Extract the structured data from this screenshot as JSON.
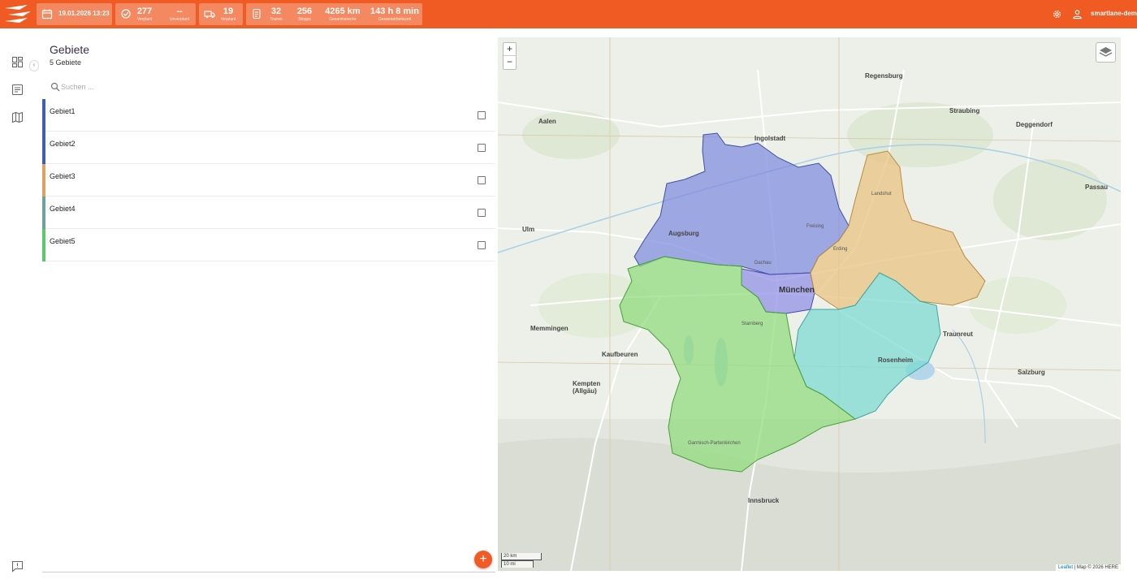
{
  "topbar": {
    "date": "19.01.2026 13:23",
    "stats_a": [
      {
        "value": "277",
        "label": "Verplant"
      },
      {
        "value": "--",
        "label": "Unverplant"
      }
    ],
    "stats_b": [
      {
        "value": "19",
        "label": "Verplant"
      }
    ],
    "stats_c": [
      {
        "value": "32",
        "label": "Touren"
      },
      {
        "value": "256",
        "label": "Stopps"
      },
      {
        "value": "4265 km",
        "label": "Gesamtstrecke"
      },
      {
        "value": "143 h 8 min",
        "label": "Gesamtarbeitszeit"
      }
    ],
    "user": "smartlane-demo",
    "icons": [
      "logo-icon",
      "calendar-icon",
      "orders-icon",
      "truck-icon",
      "route-icon",
      "gear-icon",
      "user-icon"
    ]
  },
  "rail": {
    "icons": [
      "dashboard-icon",
      "list-icon",
      "map-icon",
      "feedback-icon"
    ],
    "toggle": "‹"
  },
  "panel": {
    "title": "Gebiete",
    "count": "5 Gebiete",
    "search_placeholder": "Suchen ...",
    "areas": [
      {
        "name": "Gebiet1",
        "color": "#3f5fb5"
      },
      {
        "name": "Gebiet2",
        "color": "#3f5fb5"
      },
      {
        "name": "Gebiet3",
        "color": "#e0a060"
      },
      {
        "name": "Gebiet4",
        "color": "#6aa3a0"
      },
      {
        "name": "Gebiet5",
        "color": "#5cc86a"
      }
    ],
    "add": "+"
  },
  "map": {
    "zoom_in": "+",
    "zoom_out": "−",
    "scale_km": "20 km",
    "scale_mi": "10 mi",
    "attribution_leaflet": "Leaflet",
    "attribution_rest": " | Map © 2026 HERE",
    "region_colors": {
      "purple": "#8f8ee8",
      "blue": "#7e8bde",
      "orange": "#e9c07e",
      "teal": "#7ad9d2",
      "green": "#8fdb7c"
    },
    "cities": {
      "augsburg": "Augsburg",
      "muenchen": "München",
      "ingolstadt": "Ingolstadt",
      "regensburg": "Regensburg",
      "ulm": "Ulm",
      "memmingen": "Memmingen",
      "kaufbeuren": "Kaufbeuren",
      "kempten": "Kempten (Allgäu)",
      "rosenheim": "Rosenheim",
      "salzburg": "Salzburg",
      "innsbruck": "Innsbruck",
      "passau": "Passau",
      "straubing": "Straubing",
      "deggendorf": "Deggendorf",
      "landshut": "Landshut",
      "freising": "Freising",
      "erding": "Erding",
      "dachau": "Dachau",
      "starnberg": "Starnberg",
      "traunreut": "Traunreut",
      "aalen": "Aalen",
      "garmisch": "Garmisch-Partenkirchen"
    }
  }
}
